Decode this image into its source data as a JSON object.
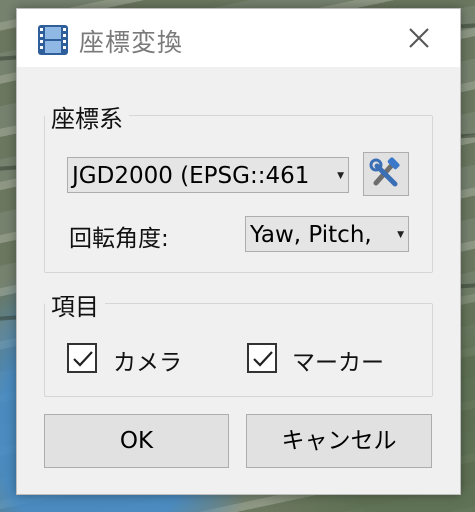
{
  "window": {
    "title": "座標変換"
  },
  "coordinate_system": {
    "group_label": "座標系",
    "crs_value": "JGD2000 (EPSG::461",
    "rotation_label": "回転角度:",
    "rotation_value": "Yaw, Pitch,"
  },
  "items": {
    "group_label": "項目",
    "camera": {
      "label": "カメラ",
      "checked": true
    },
    "marker": {
      "label": "マーカー",
      "checked": true
    }
  },
  "buttons": {
    "ok": "OK",
    "cancel": "キャンセル"
  },
  "icons": {
    "app": "film-icon",
    "close": "close-icon",
    "tool": "tools-icon",
    "dropdown": "chevron-down-icon",
    "check": "checkmark-icon"
  }
}
